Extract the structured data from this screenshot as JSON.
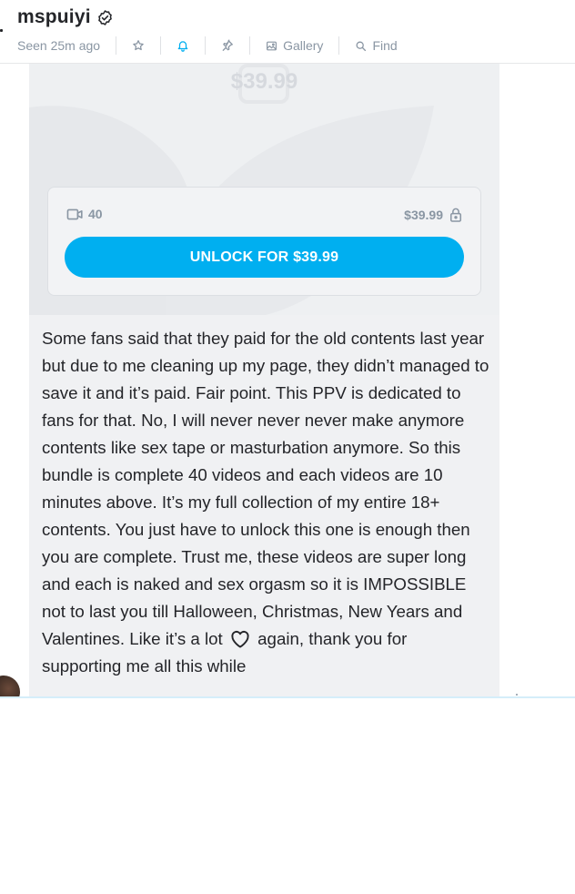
{
  "header": {
    "username": "mspuiyi",
    "verified_icon": "verified-badge-icon",
    "seen": "Seen 25m ago",
    "toolbar": {
      "star_icon": "star-icon",
      "bell_icon": "bell-icon",
      "pin_icon": "pin-icon",
      "gallery_label": "Gallery",
      "gallery_icon": "image-icon",
      "find_label": "Find",
      "find_icon": "search-icon"
    }
  },
  "message": {
    "blurred_price": "$39.99",
    "media_count": "40",
    "media_icon": "video-icon",
    "price": "$39.99",
    "lock_icon": "lock-icon",
    "unlock_button": "UNLOCK FOR $39.99",
    "text_before_heart": "Some fans said that they paid for the old contents last year but due to me cleaning up my page, they didn’t managed to save it and it’s paid. Fair point. This PPV is dedicated to fans for that. No, I will never never never make anymore contents like sex tape or masturbation anymore. So this bundle is complete 40 videos and each videos are 10 minutes above. It’s my full collec­tion of my entire 18+ contents. You just have to unlock this one is enough then you are complete. Trust me, these videos are super long and each is naked and sex orgasm so it is IMPOSSIBLE not to last you till Halloween, Christmas, New Years and Valentines. Like it’s a lot",
    "heart_icon": "heart-icon",
    "text_after_heart": " again, thank you for supporting me all this while"
  },
  "colors": {
    "accent": "#00aff0",
    "muted": "#8a96a3",
    "text": "#242529",
    "bubble_bg": "#f0f1f3"
  }
}
